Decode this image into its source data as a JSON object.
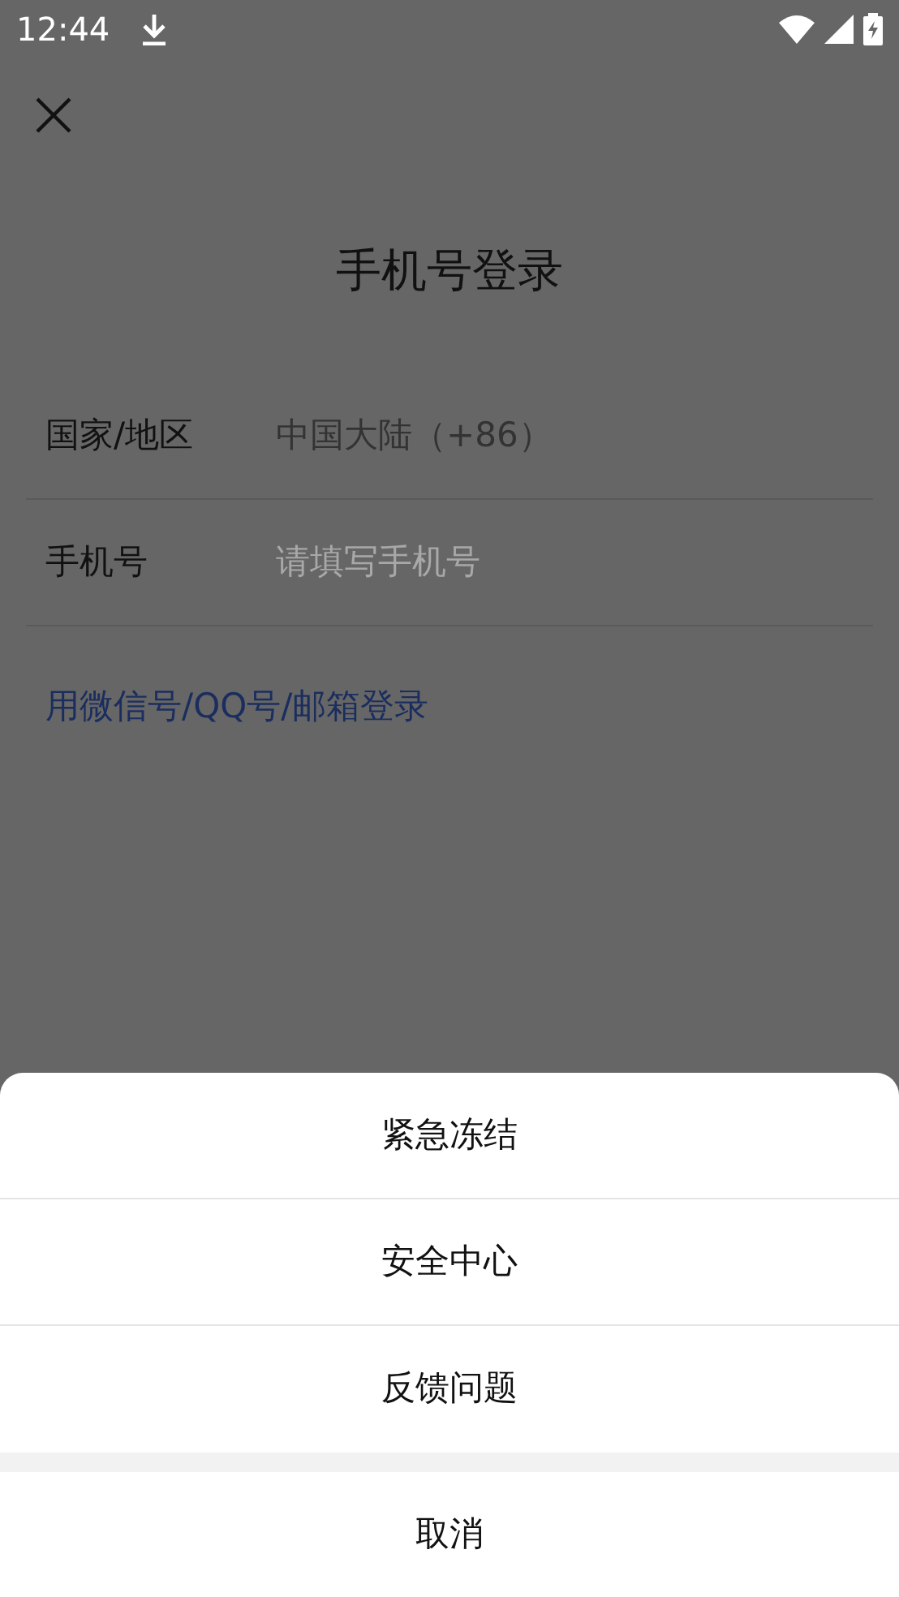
{
  "status_bar": {
    "time": "12:44"
  },
  "title": "手机号登录",
  "fields": [
    {
      "label": "国家/地区",
      "value": "中国大陆（+86）"
    },
    {
      "label": "手机号",
      "placeholder": "请填写手机号"
    }
  ],
  "alt_login_link": "用微信号/QQ号/邮箱登录",
  "action_sheet": {
    "items": [
      "紧急冻结",
      "安全中心",
      "反馈问题"
    ],
    "cancel": "取消"
  }
}
